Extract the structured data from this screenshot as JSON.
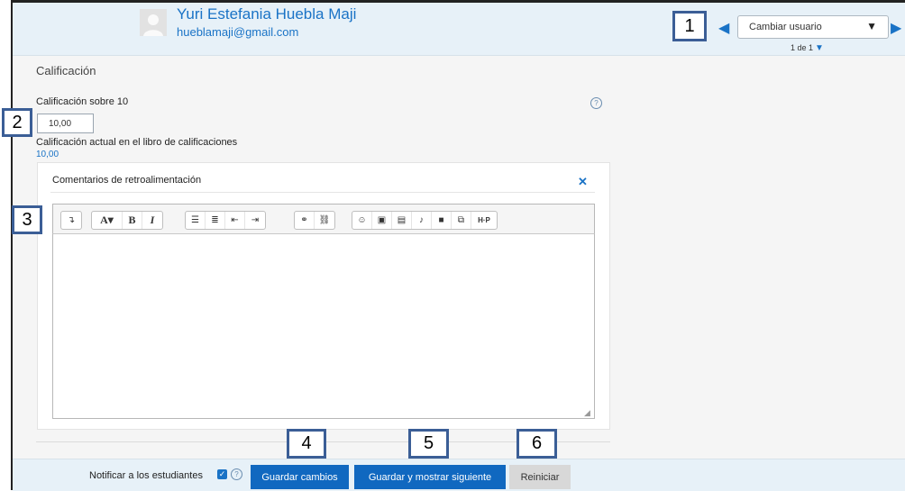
{
  "header": {
    "user_name": "Yuri Estefania Huebla Maji",
    "user_email": "hueblamaji@gmail.com",
    "change_user": "Cambiar usuario",
    "pager": "1 de 1"
  },
  "callouts": [
    "1",
    "2",
    "3",
    "4",
    "5",
    "6"
  ],
  "grade": {
    "section_title": "Calificación",
    "label": "Calificación sobre 10",
    "value": "10,00",
    "current_label": "Calificación actual en el libro de calificaciones",
    "current_value": "10,00"
  },
  "feedback": {
    "title": "Comentarios de retroalimentación",
    "toolbar": [
      [
        "expand-toolbar-icon"
      ],
      [
        "font-color-icon",
        "bold-icon",
        "italic-icon"
      ],
      [
        "unordered-list-icon",
        "ordered-list-icon",
        "outdent-icon",
        "indent-icon"
      ],
      [
        "link-icon",
        "unlink-icon"
      ],
      [
        "emoji-icon",
        "image-icon",
        "media-icon",
        "record-audio-icon",
        "record-video-icon",
        "manage-files-icon",
        "h5p-icon"
      ]
    ]
  },
  "footer": {
    "notify_label": "Notificar a los estudiantes",
    "notify_checked": true,
    "save_button": "Guardar cambios",
    "save_next_button": "Guardar y mostrar siguiente",
    "reset_button": "Reiniciar"
  },
  "colors": {
    "accent": "#1a73c6",
    "primary_button": "#1068c0",
    "header_bg": "#e7f1f8",
    "callout_border": "#3b5e96"
  }
}
